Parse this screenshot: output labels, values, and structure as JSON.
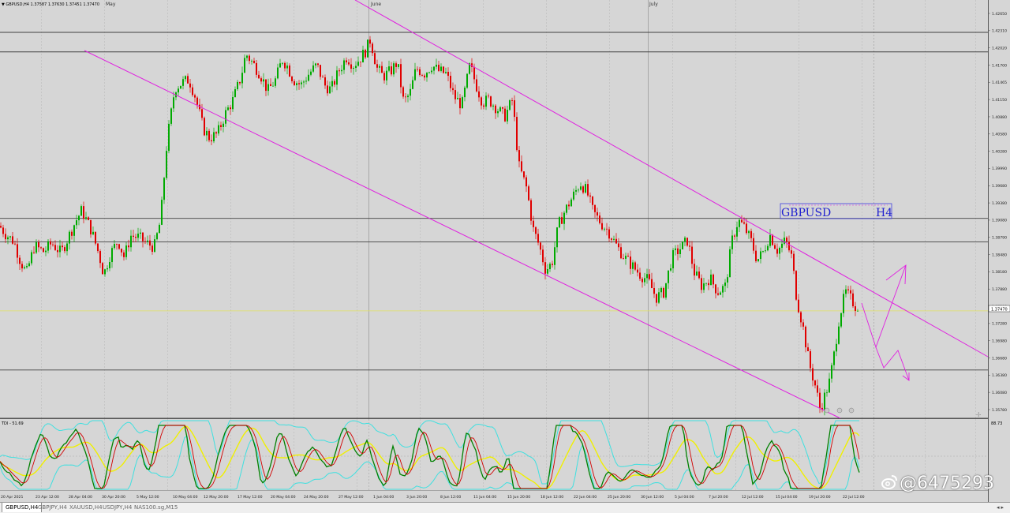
{
  "header": {
    "info": "▼ GBPUSD,H4  1.37587 1.37630 1.37451 1.37470"
  },
  "colors": {
    "background": "#d6d6d6",
    "bull": "#00aa00",
    "bear": "#e00000",
    "channel": "#e020e0",
    "level": "#404040",
    "price_line": "#e0e060",
    "watermark": "#ffffff"
  },
  "label_box": {
    "symbol": "GBPUSD",
    "timeframe": "H4"
  },
  "months": [
    "May",
    "June",
    "July"
  ],
  "current_price_label": "1.37470",
  "indicator": {
    "label": "TDI - 51.69",
    "right_label": "88.73"
  },
  "watermark": "@6475293",
  "tabs": [
    "GBPUSD,H4",
    "GBPJPY,H4",
    "XAUUSD,H4",
    "USDJPY,H4",
    "NAS100.sg,M15"
  ],
  "chart_data": {
    "type": "candlestick",
    "title": "GBPUSD,H4",
    "ylim": [
      1.3555,
      1.4275
    ],
    "y_ticks": [
      1.4265,
      1.4235,
      1.4205,
      1.4175,
      1.4145,
      1.4115,
      1.4085,
      1.4055,
      1.4025,
      1.3995,
      1.3965,
      1.3935,
      1.3905,
      1.3875,
      1.3845,
      1.3815,
      1.3785,
      1.3755,
      1.3725,
      1.3695,
      1.3665,
      1.3635,
      1.3605,
      1.3575
    ],
    "y_tick_labels": [
      "1.42650",
      "1.42310",
      "1.42020",
      "1.41700",
      "1.41465",
      "1.41150",
      "1.40880",
      "1.40580",
      "1.40280",
      "1.39990",
      "1.39680",
      "1.39380",
      "1.39080",
      "1.38790",
      "1.38480",
      "1.38180",
      "1.37880",
      "1.37590",
      "1.37280",
      "1.36980",
      "1.36680",
      "1.36380",
      "1.36080",
      "1.35780"
    ],
    "x_labels": [
      "20 Apr 2021",
      "23 Apr 12:00",
      "28 Apr 04:00",
      "30 Apr 20:00",
      "5 May 12:00",
      "10 May 04:00",
      "12 May 20:00",
      "17 May 12:00",
      "20 May 04:00",
      "24 May 20:00",
      "27 May 12:00",
      "1 Jun 04:00",
      "3 Jun 20:00",
      "8 Jun 12:00",
      "11 Jun 04:00",
      "15 Jun 20:00",
      "18 Jun 12:00",
      "22 Jun 04:00",
      "25 Jun 20:00",
      "30 Jun 12:00",
      "5 Jul 04:00",
      "7 Jul 20:00",
      "12 Jul 12:00",
      "15 Jul 04:00",
      "19 Jul 20:00",
      "22 Jul 12:00"
    ],
    "horizontal_levels": [
      1.4232,
      1.4198,
      1.3908,
      1.3867,
      1.3644,
      1.356
    ],
    "current_price": 1.3747,
    "path": [
      [
        0,
        1.3895
      ],
      [
        8,
        1.388
      ],
      [
        18,
        1.3868
      ],
      [
        26,
        1.3835
      ],
      [
        34,
        1.3812
      ],
      [
        44,
        1.386
      ],
      [
        56,
        1.385
      ],
      [
        66,
        1.3865
      ],
      [
        78,
        1.3848
      ],
      [
        86,
        1.3872
      ],
      [
        96,
        1.3902
      ],
      [
        104,
        1.3922
      ],
      [
        116,
        1.3888
      ],
      [
        126,
        1.3845
      ],
      [
        132,
        1.381
      ],
      [
        140,
        1.3845
      ],
      [
        150,
        1.387
      ],
      [
        158,
        1.384
      ],
      [
        166,
        1.3878
      ],
      [
        176,
        1.3875
      ],
      [
        186,
        1.3865
      ],
      [
        196,
        1.3858
      ],
      [
        204,
        1.3905
      ],
      [
        212,
        1.404
      ],
      [
        222,
        1.4135
      ],
      [
        232,
        1.4145
      ],
      [
        240,
        1.415
      ],
      [
        248,
        1.412
      ],
      [
        258,
        1.4065
      ],
      [
        266,
        1.4048
      ],
      [
        276,
        1.4055
      ],
      [
        286,
        1.409
      ],
      [
        296,
        1.4115
      ],
      [
        306,
        1.4155
      ],
      [
        312,
        1.4195
      ],
      [
        320,
        1.418
      ],
      [
        330,
        1.416
      ],
      [
        340,
        1.413
      ],
      [
        350,
        1.415
      ],
      [
        358,
        1.4185
      ],
      [
        364,
        1.4175
      ],
      [
        372,
        1.415
      ],
      [
        382,
        1.414
      ],
      [
        392,
        1.416
      ],
      [
        402,
        1.4175
      ],
      [
        412,
        1.414
      ],
      [
        420,
        1.4132
      ],
      [
        430,
        1.4165
      ],
      [
        440,
        1.419
      ],
      [
        448,
        1.4175
      ],
      [
        456,
        1.4185
      ],
      [
        464,
        1.42
      ],
      [
        470,
        1.422
      ],
      [
        478,
        1.417
      ],
      [
        486,
        1.4155
      ],
      [
        496,
        1.4165
      ],
      [
        504,
        1.418
      ],
      [
        512,
        1.411
      ],
      [
        520,
        1.4125
      ],
      [
        528,
        1.417
      ],
      [
        538,
        1.416
      ],
      [
        548,
        1.4175
      ],
      [
        556,
        1.4165
      ],
      [
        566,
        1.416
      ],
      [
        576,
        1.412
      ],
      [
        586,
        1.4105
      ],
      [
        596,
        1.4175
      ],
      [
        604,
        1.414
      ],
      [
        612,
        1.411
      ],
      [
        620,
        1.4115
      ],
      [
        630,
        1.41
      ],
      [
        640,
        1.4085
      ],
      [
        650,
        1.4115
      ],
      [
        658,
        1.4
      ],
      [
        668,
        1.396
      ],
      [
        676,
        1.389
      ],
      [
        684,
        1.386
      ],
      [
        692,
        1.3818
      ],
      [
        700,
        1.383
      ],
      [
        708,
        1.3895
      ],
      [
        716,
        1.392
      ],
      [
        726,
        1.3945
      ],
      [
        736,
        1.397
      ],
      [
        744,
        1.3955
      ],
      [
        752,
        1.392
      ],
      [
        762,
        1.39
      ],
      [
        772,
        1.3885
      ],
      [
        782,
        1.386
      ],
      [
        792,
        1.384
      ],
      [
        802,
        1.3825
      ],
      [
        812,
        1.381
      ],
      [
        822,
        1.38
      ],
      [
        832,
        1.377
      ],
      [
        842,
        1.378
      ],
      [
        852,
        1.384
      ],
      [
        862,
        1.3855
      ],
      [
        872,
        1.387
      ],
      [
        880,
        1.3815
      ],
      [
        890,
        1.379
      ],
      [
        900,
        1.3805
      ],
      [
        910,
        1.378
      ],
      [
        920,
        1.379
      ],
      [
        928,
        1.3868
      ],
      [
        936,
        1.3905
      ],
      [
        944,
        1.3892
      ],
      [
        952,
        1.387
      ],
      [
        960,
        1.3835
      ],
      [
        968,
        1.385
      ],
      [
        976,
        1.388
      ],
      [
        986,
        1.3852
      ],
      [
        996,
        1.387
      ],
      [
        1004,
        1.384
      ],
      [
        1010,
        1.377
      ],
      [
        1018,
        1.372
      ],
      [
        1026,
        1.3655
      ],
      [
        1034,
        1.3615
      ],
      [
        1040,
        1.3575
      ],
      [
        1046,
        1.36
      ],
      [
        1052,
        1.3625
      ],
      [
        1058,
        1.3675
      ],
      [
        1064,
        1.3735
      ],
      [
        1072,
        1.378
      ],
      [
        1080,
        1.3765
      ],
      [
        1088,
        1.3748
      ]
    ]
  }
}
